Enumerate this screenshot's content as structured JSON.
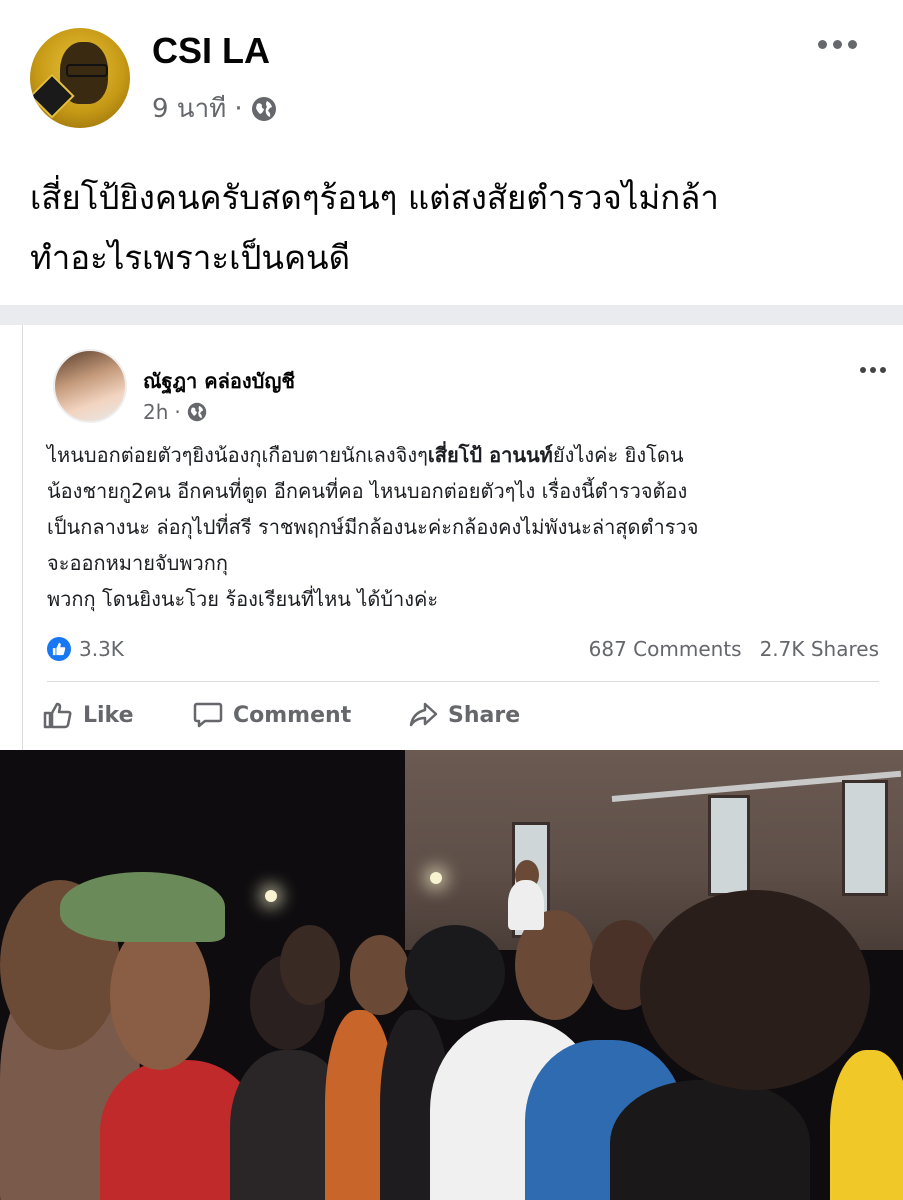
{
  "outer_post": {
    "author": "CSI LA",
    "time": "9 นาที",
    "dot": "·",
    "privacy_icon": "globe-icon",
    "text_lines": [
      "เสี่ยโป้ยิงคนครับสดๆร้อนๆ แต่สงสัยตำรวจไม่กล้า",
      "ทำอะไรเพราะเป็นคนดี"
    ]
  },
  "shared_post": {
    "author": "ณัฐฎา คล่องบัญชี",
    "time": "2h",
    "dot": "·",
    "privacy_icon": "globe-icon",
    "text": {
      "line1_a": "ไหนบอกต่อยตัวๆยิงน้องกุเกือบตายนักเลงจิงๆ",
      "line1_b": "เสี่ยโป้ อานนท์",
      "line1_c": "ยังไงค่ะ ยิงโดน",
      "line2": "น้องชายกู2คน อีกคนที่ตูด อีกคนที่คอ ไหนบอกต่อยตัวๆไง เรื่องนี้ตำรวจต้อง",
      "line3": "เป็นกลางนะ ล่อกุไปที่สรี ราชพฤกษ์มีกล้องนะค่ะกล้องคงไม่พังนะล่าสุดตำรวจ",
      "line4": "จะออกหมายจับพวกกุ",
      "line5": "พวกกุ โดนยิงนะโวย ร้องเรียนที่ไหน ได้บ้างค่ะ"
    },
    "reactions": "3.3K",
    "comments": "687 Comments",
    "shares": "2.7K Shares",
    "actions": {
      "like": "Like",
      "comment": "Comment",
      "share": "Share"
    }
  },
  "colors": {
    "facebook_blue": "#1877f2",
    "secondary_text": "#65676b",
    "divider": "#e9ebee"
  }
}
